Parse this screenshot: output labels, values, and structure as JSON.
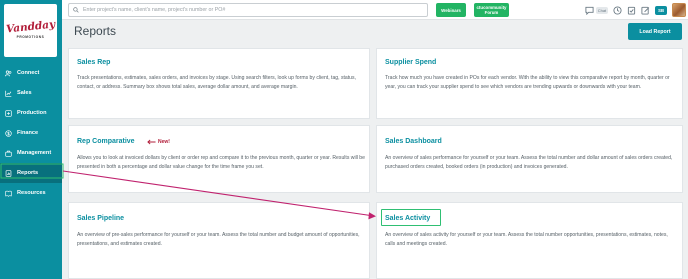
{
  "logo": {
    "main": "Vandday",
    "sub": "PROMOTIONS"
  },
  "sidebar": {
    "items": [
      {
        "label": "Connect",
        "icon": "users-icon"
      },
      {
        "label": "Sales",
        "icon": "chart-line-icon"
      },
      {
        "label": "Production",
        "icon": "wrench-icon"
      },
      {
        "label": "Finance",
        "icon": "dollar-icon"
      },
      {
        "label": "Management",
        "icon": "briefcase-icon"
      },
      {
        "label": "Reports",
        "icon": "file-chart-icon",
        "active": true
      },
      {
        "label": "Resources",
        "icon": "book-icon"
      }
    ]
  },
  "topbar": {
    "search_placeholder": "Enter project's name, client's name, project's number or PO#",
    "webinars_label": "Webinars",
    "forum_label": "ctucommunity Forum",
    "chat_label": "Chat",
    "user_initials": "SB"
  },
  "page": {
    "title": "Reports",
    "load_report_label": "Load Report"
  },
  "cards": [
    {
      "title": "Sales Rep",
      "desc": "Track presentations, estimates, sales orders, and invoices by stage. Using search filters, look up forms by client, tag, status, contact, or address. Summary box shows total sales, average dollar amount, and average margin."
    },
    {
      "title": "Supplier Spend",
      "desc": "Track how much you have created in POs for each vendor. With the ability to view this comparative report by month, quarter or year, you can track your supplier spend to see which vendors are trending upwards or downwards with your team."
    },
    {
      "title": "Rep Comparative",
      "new_label": "New!",
      "desc": "Allows you to look at invoiced dollars by client or order rep and compare it to the previous month, quarter or year. Results will be presented in both a percentage and dollar value change for the time frame you set."
    },
    {
      "title": "Sales Dashboard",
      "desc": "An overview of sales performance for yourself or your team. Assess the total number and dollar amount of sales orders created, purchased orders created, booked orders (in production) and invoices generated."
    },
    {
      "title": "Sales Pipeline",
      "desc": "An overview of pre-sales performance for yourself or your team. Assess the total number and budget amount of opportunities, presentations, and estimates created."
    },
    {
      "title": "Sales Activity",
      "desc": "An overview of sales activity for yourself or your team. Assess the total number opportunities, presentations, estimates, notes, calls and meetings created."
    }
  ],
  "colors": {
    "teal": "#0b8fa0",
    "green": "#22b463",
    "arrow": "#c0226e",
    "new": "#b21e3a"
  }
}
